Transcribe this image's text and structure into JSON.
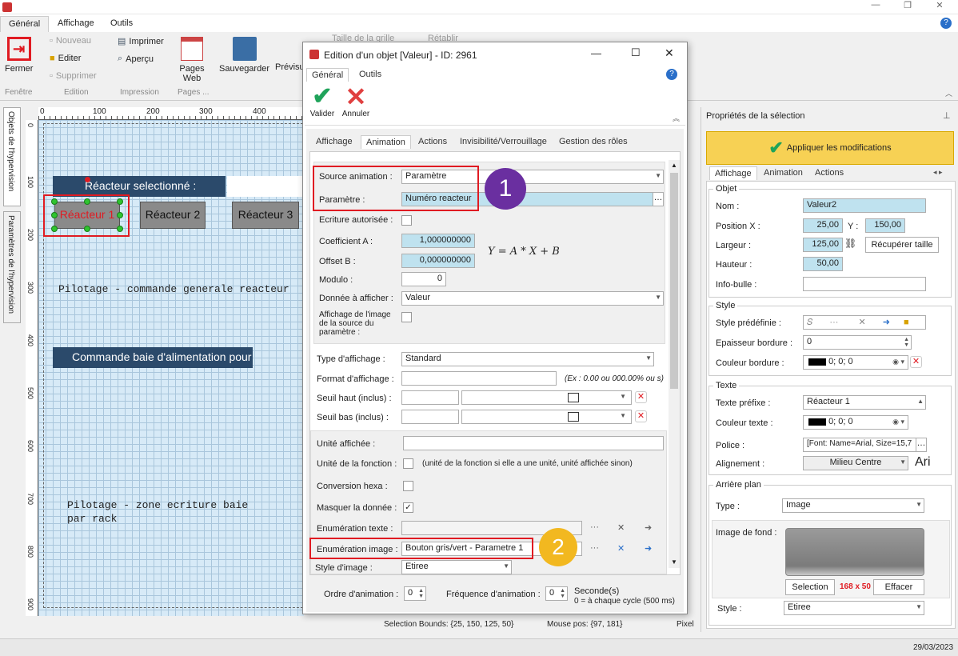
{
  "ribbon": {
    "tabs": [
      "Général",
      "Affichage",
      "Outils"
    ],
    "groups": [
      {
        "label": "Fenêtre"
      },
      {
        "label": "Edition"
      },
      {
        "label": "Impression"
      },
      {
        "label": "Pages ..."
      }
    ],
    "buttons": {
      "fermer": "Fermer",
      "nouveau": "Nouveau",
      "editer": "Editer",
      "supprimer": "Supprimer",
      "imprimer": "Imprimer",
      "apercu": "Aperçu",
      "pages_web": "Pages Web",
      "sauvegarder": "Sauvegarder",
      "previsu": "Prévisu",
      "taille_grille": "Taille de la grille",
      "retablir": "Rétablir"
    }
  },
  "left_vtabs": [
    "Objets de l'hypervision",
    "Paramètres de l'hypervision"
  ],
  "ruler": {
    "h_ticks": [
      "0",
      "100",
      "200",
      "300",
      "400"
    ],
    "v_ticks": [
      "0",
      "100",
      "200",
      "300",
      "400",
      "500",
      "600",
      "700",
      "800",
      "900"
    ]
  },
  "canvas": {
    "selected_label": "Réacteur selectionné :",
    "reactor_buttons": [
      "Réacteur 1",
      "Réacteur 2",
      "Réacteur 3"
    ],
    "pilotage_reactor": "Pilotage - commande generale reacteur",
    "commande_baie": "Commande baie d'alimentation pour",
    "pilotage_zone": "Pilotage - zone ecriture baie",
    "par_rack": "par rack"
  },
  "status": {
    "bounds": "Selection Bounds: {25, 150, 125, 50}",
    "mouse": "Mouse pos: {97, 181}",
    "unit": "Pixel",
    "date": "29/03/2023"
  },
  "dialog": {
    "title": "Edition d'un objet [Valeur] - ID: 2961",
    "tabs": [
      "Général",
      "Outils"
    ],
    "valider": "Valider",
    "annuler": "Annuler",
    "inner_tabs": [
      "Affichage",
      "Animation",
      "Actions",
      "Invisibilité/Verrouillage",
      "Gestion des rôles"
    ],
    "source_animation_label": "Source animation :",
    "source_animation_value": "Paramètre",
    "parametre_label": "Paramètre :",
    "parametre_value": "Numéro reacteur",
    "ecriture_label": "Ecriture autorisée :",
    "coef_a_label": "Coefficient A :",
    "coef_a_value": "1,000000000",
    "offset_label": "Offset B :",
    "offset_value": "0,000000000",
    "formula": "Y = A * X + B",
    "modulo_label": "Modulo :",
    "modulo_value": "0",
    "donnee_label": "Donnée à afficher :",
    "donnee_value": "Valeur",
    "affichage_image_label": "Affichage de l'image de la source du paramètre :",
    "type_affichage_label": "Type d'affichage :",
    "type_affichage_value": "Standard",
    "format_label": "Format d'affichage :",
    "format_hint": "(Ex : 0.00 ou 000.00% ou s)",
    "seuil_haut_label": "Seuil haut (inclus) :",
    "seuil_bas_label": "Seuil bas (inclus) :",
    "unite_affichee_label": "Unité affichée :",
    "unite_fonction_label": "Unité de la fonction :",
    "unite_fonction_hint": "(unité de la fonction si elle a une unité, unité affichée sinon)",
    "conversion_label": "Conversion hexa :",
    "masquer_label": "Masquer la donnée :",
    "enum_texte_label": "Enumération texte :",
    "enum_image_label": "Enumération image :",
    "enum_image_value": "Bouton gris/vert - Parametre 1",
    "style_image_label": "Style d'image :",
    "style_image_value": "Etiree",
    "ordre_label": "Ordre d'animation :",
    "ordre_value": "0",
    "frequence_label": "Fréquence d'animation :",
    "frequence_value": "0",
    "secondes": "Seconde(s)",
    "cycle_hint": "0 = à chaque cycle (500 ms)"
  },
  "markers": [
    "1",
    "2"
  ],
  "props": {
    "title": "Propriétés de la sélection",
    "apply": "Appliquer les modifications",
    "tabs": [
      "Affichage",
      "Animation",
      "Actions"
    ],
    "objet_group": "Objet",
    "nom_label": "Nom :",
    "nom_value": "Valeur2",
    "posx_label": "Position X :",
    "posx_value": "25,00",
    "y_label": "Y :",
    "y_value": "150,00",
    "largeur_label": "Largeur :",
    "largeur_value": "125,00",
    "recuperer": "Récupérer taille",
    "hauteur_label": "Hauteur :",
    "hauteur_value": "50,00",
    "infobulle_label": "Info-bulle :",
    "style_group": "Style",
    "style_predef_label": "Style prédéfinie :",
    "epaisseur_label": "Epaisseur bordure :",
    "epaisseur_value": "0",
    "couleur_bordure_label": "Couleur bordure :",
    "couleur_value": "0; 0; 0",
    "texte_group": "Texte",
    "prefixe_label": "Texte préfixe :",
    "prefixe_value": "Réacteur 1",
    "couleur_texte_label": "Couleur texte :",
    "police_label": "Police :",
    "police_value": "[Font: Name=Arial, Size=15,7",
    "alignement_label": "Alignement :",
    "alignement_value": "Milieu Centre",
    "ari": "Ari",
    "arriere_group": "Arrière plan",
    "type_label": "Type :",
    "type_value": "Image",
    "image_fond_label": "Image de fond :",
    "selection_btn": "Selection",
    "size_text": "168 x 50",
    "effacer_btn": "Effacer",
    "style_label": "Style :",
    "style_value": "Etiree"
  },
  "colors": {
    "accent_red": "#e01b22",
    "marker1": "#6a2fa0",
    "marker2": "#f2b820",
    "canvas_blue": "#d7eaf7",
    "header_dark": "#2b4a6b"
  }
}
